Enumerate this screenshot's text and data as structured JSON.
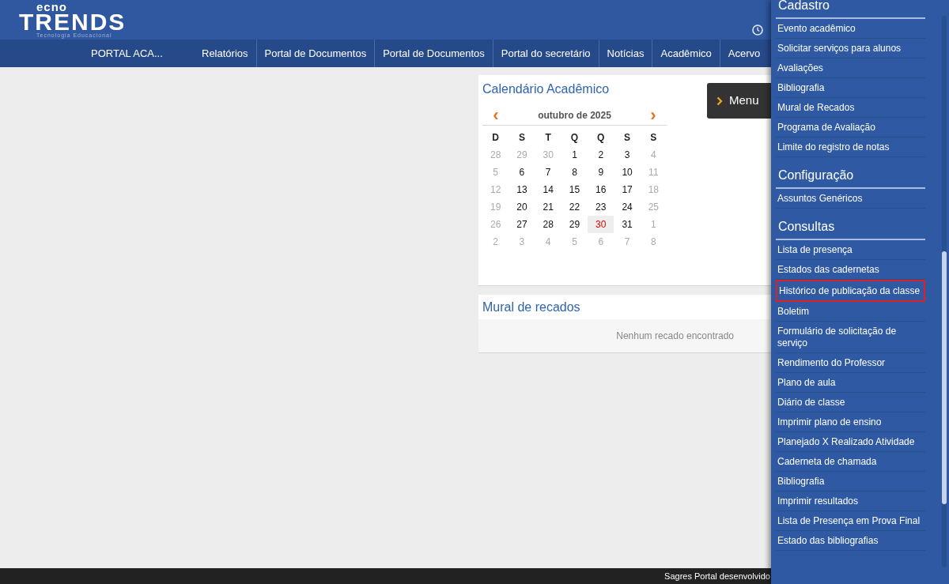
{
  "logo": {
    "top": "ecno",
    "main": "TRENDS",
    "tagline": "Tecnologia Educacional"
  },
  "nav": {
    "brand": "PORTAL ACA...",
    "items": [
      "Relatórios",
      "Portal de Documentos",
      "Portal de Documentos",
      "Portal do secretário",
      "Notícias",
      "Acadêmico",
      "Acervo"
    ]
  },
  "calendar": {
    "title": "Calendário Acadêmico",
    "prev": "‹",
    "next": "›",
    "month": "outubro de 2025",
    "weekdays": [
      "D",
      "S",
      "T",
      "Q",
      "Q",
      "S",
      "S"
    ],
    "weeks": [
      [
        {
          "day": "28",
          "muted": true
        },
        {
          "day": "29",
          "muted": true
        },
        {
          "day": "30",
          "muted": true
        },
        {
          "day": "1",
          "muted": false
        },
        {
          "day": "2",
          "muted": false
        },
        {
          "day": "3",
          "muted": false
        },
        {
          "day": "4",
          "muted": true
        }
      ],
      [
        {
          "day": "5",
          "muted": true
        },
        {
          "day": "6",
          "muted": false
        },
        {
          "day": "7",
          "muted": false
        },
        {
          "day": "8",
          "muted": false
        },
        {
          "day": "9",
          "muted": false
        },
        {
          "day": "10",
          "muted": false
        },
        {
          "day": "11",
          "muted": true
        }
      ],
      [
        {
          "day": "12",
          "muted": true
        },
        {
          "day": "13",
          "muted": false
        },
        {
          "day": "14",
          "muted": false
        },
        {
          "day": "15",
          "muted": false
        },
        {
          "day": "16",
          "muted": false
        },
        {
          "day": "17",
          "muted": false
        },
        {
          "day": "18",
          "muted": true
        }
      ],
      [
        {
          "day": "19",
          "muted": true
        },
        {
          "day": "20",
          "muted": false
        },
        {
          "day": "21",
          "muted": false
        },
        {
          "day": "22",
          "muted": false
        },
        {
          "day": "23",
          "muted": false
        },
        {
          "day": "24",
          "muted": false
        },
        {
          "day": "25",
          "muted": true
        }
      ],
      [
        {
          "day": "26",
          "muted": true
        },
        {
          "day": "27",
          "muted": false
        },
        {
          "day": "28",
          "muted": false
        },
        {
          "day": "29",
          "muted": false
        },
        {
          "day": "30",
          "muted": false,
          "today": true
        },
        {
          "day": "31",
          "muted": false
        },
        {
          "day": "1",
          "muted": true
        }
      ],
      [
        {
          "day": "2",
          "muted": true
        },
        {
          "day": "3",
          "muted": true
        },
        {
          "day": "4",
          "muted": true
        },
        {
          "day": "5",
          "muted": true
        },
        {
          "day": "6",
          "muted": true
        },
        {
          "day": "7",
          "muted": true
        },
        {
          "day": "8",
          "muted": true
        }
      ]
    ]
  },
  "mural": {
    "title": "Mural de recados",
    "empty": "Nenhum recado encontrado"
  },
  "menu_button": {
    "label": "Menu"
  },
  "sidebar": {
    "sections": [
      {
        "title": "Cadastro",
        "items": [
          {
            "label": "Evento acadêmico",
            "selected": false
          },
          {
            "label": "Solicitar serviços para alunos",
            "selected": false
          },
          {
            "label": "Avaliações",
            "selected": false
          },
          {
            "label": "Bibliografia",
            "selected": false
          },
          {
            "label": "Mural de Recados",
            "selected": false
          },
          {
            "label": "Programa de Avaliação",
            "selected": false
          },
          {
            "label": "Limite do registro de notas",
            "selected": false
          }
        ]
      },
      {
        "title": "Configuração",
        "items": [
          {
            "label": "Assuntos Genéricos",
            "selected": false
          }
        ]
      },
      {
        "title": "Consultas",
        "items": [
          {
            "label": "Lista de presença",
            "selected": false
          },
          {
            "label": "Estados das cadernetas",
            "selected": false
          },
          {
            "label": "Histórico de publicação da classe",
            "selected": true
          },
          {
            "label": "Boletim",
            "selected": false
          },
          {
            "label": "Formulário de solicitação de serviço",
            "selected": false
          },
          {
            "label": "Rendimento do Professor",
            "selected": false
          },
          {
            "label": "Plano de aula",
            "selected": false
          },
          {
            "label": "Diário de classe",
            "selected": false
          },
          {
            "label": "Imprimir plano de ensino",
            "selected": false
          },
          {
            "label": "Planejado X Realizado Atividade",
            "selected": false
          },
          {
            "label": "Caderneta de chamada",
            "selected": false
          },
          {
            "label": "Bibliografia",
            "selected": false
          },
          {
            "label": "Imprimir resultados",
            "selected": false
          },
          {
            "label": "Lista de Presença em Prova Final",
            "selected": false
          },
          {
            "label": "Estado das bibliografias",
            "selected": false
          }
        ]
      }
    ]
  },
  "footer": {
    "text": "Sagres Portal desenvolvido"
  }
}
